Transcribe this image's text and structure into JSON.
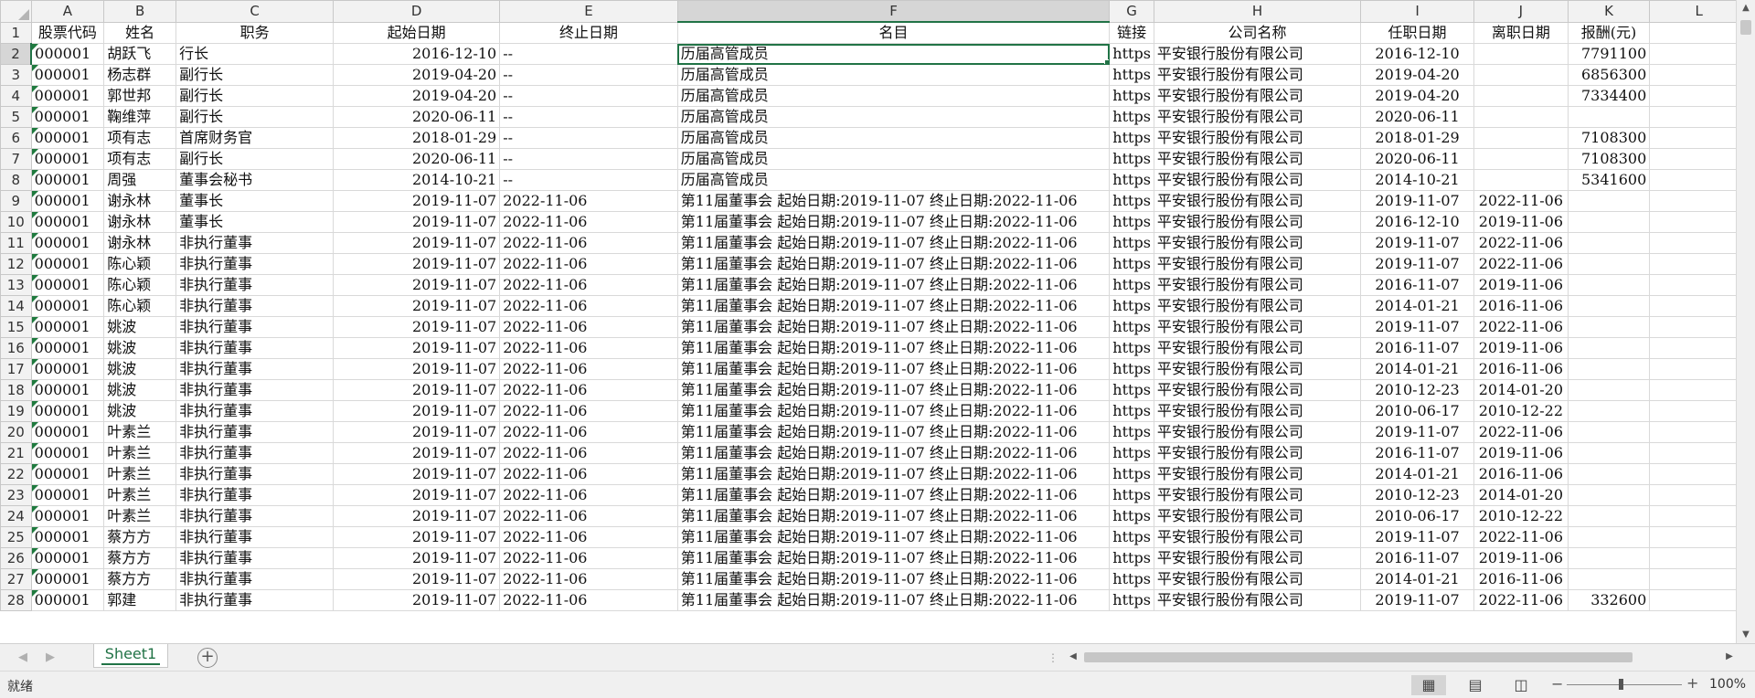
{
  "sheet": {
    "columns": [
      "A",
      "B",
      "C",
      "D",
      "E",
      "F",
      "G",
      "H",
      "I",
      "J",
      "K",
      "L"
    ],
    "selected_column": "F",
    "selected_row": 2,
    "rows": [
      {
        "n": "1",
        "c": [
          "股票代码",
          "姓名",
          "职务",
          "起始日期",
          "终止日期",
          "名目",
          "链接",
          "公司名称",
          "任职日期",
          "离职日期",
          "报酬(元)",
          ""
        ]
      },
      {
        "n": "2",
        "c": [
          "000001",
          "胡跃飞",
          "行长",
          "2016-12-10",
          "--",
          "历届高管成员",
          "https",
          "平安银行股份有限公司",
          "2016-12-10",
          "",
          "7791100",
          ""
        ]
      },
      {
        "n": "3",
        "c": [
          "000001",
          "杨志群",
          "副行长",
          "2019-04-20",
          "--",
          "历届高管成员",
          "https",
          "平安银行股份有限公司",
          "2019-04-20",
          "",
          "6856300",
          ""
        ]
      },
      {
        "n": "4",
        "c": [
          "000001",
          "郭世邦",
          "副行长",
          "2019-04-20",
          "--",
          "历届高管成员",
          "https",
          "平安银行股份有限公司",
          "2019-04-20",
          "",
          "7334400",
          ""
        ]
      },
      {
        "n": "5",
        "c": [
          "000001",
          "鞠维萍",
          "副行长",
          "2020-06-11",
          "--",
          "历届高管成员",
          "https",
          "平安银行股份有限公司",
          "2020-06-11",
          "",
          "",
          ""
        ]
      },
      {
        "n": "6",
        "c": [
          "000001",
          "项有志",
          "首席财务官",
          "2018-01-29",
          "--",
          "历届高管成员",
          "https",
          "平安银行股份有限公司",
          "2018-01-29",
          "",
          "7108300",
          ""
        ]
      },
      {
        "n": "7",
        "c": [
          "000001",
          "项有志",
          "副行长",
          "2020-06-11",
          "--",
          "历届高管成员",
          "https",
          "平安银行股份有限公司",
          "2020-06-11",
          "",
          "7108300",
          ""
        ]
      },
      {
        "n": "8",
        "c": [
          "000001",
          "周强",
          "董事会秘书",
          "2014-10-21",
          "--",
          "历届高管成员",
          "https",
          "平安银行股份有限公司",
          "2014-10-21",
          "",
          "5341600",
          ""
        ]
      },
      {
        "n": "9",
        "c": [
          "000001",
          "谢永林",
          "董事长",
          "2019-11-07",
          "2022-11-06",
          "第11届董事会  起始日期:2019-11-07  终止日期:2022-11-06",
          "https",
          "平安银行股份有限公司",
          "2019-11-07",
          "2022-11-06",
          "",
          ""
        ]
      },
      {
        "n": "10",
        "c": [
          "000001",
          "谢永林",
          "董事长",
          "2019-11-07",
          "2022-11-06",
          "第11届董事会  起始日期:2019-11-07  终止日期:2022-11-06",
          "https",
          "平安银行股份有限公司",
          "2016-12-10",
          "2019-11-06",
          "",
          ""
        ]
      },
      {
        "n": "11",
        "c": [
          "000001",
          "谢永林",
          "非执行董事",
          "2019-11-07",
          "2022-11-06",
          "第11届董事会  起始日期:2019-11-07  终止日期:2022-11-06",
          "https",
          "平安银行股份有限公司",
          "2019-11-07",
          "2022-11-06",
          "",
          ""
        ]
      },
      {
        "n": "12",
        "c": [
          "000001",
          "陈心颖",
          "非执行董事",
          "2019-11-07",
          "2022-11-06",
          "第11届董事会  起始日期:2019-11-07  终止日期:2022-11-06",
          "https",
          "平安银行股份有限公司",
          "2019-11-07",
          "2022-11-06",
          "",
          ""
        ]
      },
      {
        "n": "13",
        "c": [
          "000001",
          "陈心颖",
          "非执行董事",
          "2019-11-07",
          "2022-11-06",
          "第11届董事会  起始日期:2019-11-07  终止日期:2022-11-06",
          "https",
          "平安银行股份有限公司",
          "2016-11-07",
          "2019-11-06",
          "",
          ""
        ]
      },
      {
        "n": "14",
        "c": [
          "000001",
          "陈心颖",
          "非执行董事",
          "2019-11-07",
          "2022-11-06",
          "第11届董事会  起始日期:2019-11-07  终止日期:2022-11-06",
          "https",
          "平安银行股份有限公司",
          "2014-01-21",
          "2016-11-06",
          "",
          ""
        ]
      },
      {
        "n": "15",
        "c": [
          "000001",
          "姚波",
          "非执行董事",
          "2019-11-07",
          "2022-11-06",
          "第11届董事会  起始日期:2019-11-07  终止日期:2022-11-06",
          "https",
          "平安银行股份有限公司",
          "2019-11-07",
          "2022-11-06",
          "",
          ""
        ]
      },
      {
        "n": "16",
        "c": [
          "000001",
          "姚波",
          "非执行董事",
          "2019-11-07",
          "2022-11-06",
          "第11届董事会  起始日期:2019-11-07  终止日期:2022-11-06",
          "https",
          "平安银行股份有限公司",
          "2016-11-07",
          "2019-11-06",
          "",
          ""
        ]
      },
      {
        "n": "17",
        "c": [
          "000001",
          "姚波",
          "非执行董事",
          "2019-11-07",
          "2022-11-06",
          "第11届董事会  起始日期:2019-11-07  终止日期:2022-11-06",
          "https",
          "平安银行股份有限公司",
          "2014-01-21",
          "2016-11-06",
          "",
          ""
        ]
      },
      {
        "n": "18",
        "c": [
          "000001",
          "姚波",
          "非执行董事",
          "2019-11-07",
          "2022-11-06",
          "第11届董事会  起始日期:2019-11-07  终止日期:2022-11-06",
          "https",
          "平安银行股份有限公司",
          "2010-12-23",
          "2014-01-20",
          "",
          ""
        ]
      },
      {
        "n": "19",
        "c": [
          "000001",
          "姚波",
          "非执行董事",
          "2019-11-07",
          "2022-11-06",
          "第11届董事会  起始日期:2019-11-07  终止日期:2022-11-06",
          "https",
          "平安银行股份有限公司",
          "2010-06-17",
          "2010-12-22",
          "",
          ""
        ]
      },
      {
        "n": "20",
        "c": [
          "000001",
          "叶素兰",
          "非执行董事",
          "2019-11-07",
          "2022-11-06",
          "第11届董事会  起始日期:2019-11-07  终止日期:2022-11-06",
          "https",
          "平安银行股份有限公司",
          "2019-11-07",
          "2022-11-06",
          "",
          ""
        ]
      },
      {
        "n": "21",
        "c": [
          "000001",
          "叶素兰",
          "非执行董事",
          "2019-11-07",
          "2022-11-06",
          "第11届董事会  起始日期:2019-11-07  终止日期:2022-11-06",
          "https",
          "平安银行股份有限公司",
          "2016-11-07",
          "2019-11-06",
          "",
          ""
        ]
      },
      {
        "n": "22",
        "c": [
          "000001",
          "叶素兰",
          "非执行董事",
          "2019-11-07",
          "2022-11-06",
          "第11届董事会  起始日期:2019-11-07  终止日期:2022-11-06",
          "https",
          "平安银行股份有限公司",
          "2014-01-21",
          "2016-11-06",
          "",
          ""
        ]
      },
      {
        "n": "23",
        "c": [
          "000001",
          "叶素兰",
          "非执行董事",
          "2019-11-07",
          "2022-11-06",
          "第11届董事会  起始日期:2019-11-07  终止日期:2022-11-06",
          "https",
          "平安银行股份有限公司",
          "2010-12-23",
          "2014-01-20",
          "",
          ""
        ]
      },
      {
        "n": "24",
        "c": [
          "000001",
          "叶素兰",
          "非执行董事",
          "2019-11-07",
          "2022-11-06",
          "第11届董事会  起始日期:2019-11-07  终止日期:2022-11-06",
          "https",
          "平安银行股份有限公司",
          "2010-06-17",
          "2010-12-22",
          "",
          ""
        ]
      },
      {
        "n": "25",
        "c": [
          "000001",
          "蔡方方",
          "非执行董事",
          "2019-11-07",
          "2022-11-06",
          "第11届董事会  起始日期:2019-11-07  终止日期:2022-11-06",
          "https",
          "平安银行股份有限公司",
          "2019-11-07",
          "2022-11-06",
          "",
          ""
        ]
      },
      {
        "n": "26",
        "c": [
          "000001",
          "蔡方方",
          "非执行董事",
          "2019-11-07",
          "2022-11-06",
          "第11届董事会  起始日期:2019-11-07  终止日期:2022-11-06",
          "https",
          "平安银行股份有限公司",
          "2016-11-07",
          "2019-11-06",
          "",
          ""
        ]
      },
      {
        "n": "27",
        "c": [
          "000001",
          "蔡方方",
          "非执行董事",
          "2019-11-07",
          "2022-11-06",
          "第11届董事会  起始日期:2019-11-07  终止日期:2022-11-06",
          "https",
          "平安银行股份有限公司",
          "2014-01-21",
          "2016-11-06",
          "",
          ""
        ]
      },
      {
        "n": "28",
        "c": [
          "000001",
          "郭建",
          "非执行董事",
          "2019-11-07",
          "2022-11-06",
          "第11届董事会  起始日期:2019-11-07  终止日期:2022-11-06",
          "https",
          "平安银行股份有限公司",
          "2019-11-07",
          "2022-11-06",
          "332600",
          ""
        ]
      }
    ]
  },
  "tabs": [
    {
      "label": "Sheet1",
      "active": true
    }
  ],
  "status": {
    "text": "就绪",
    "zoom": "100%"
  },
  "icons": {
    "add_sheet": "plus-circle-icon",
    "normal_view": "grid-icon",
    "page_layout": "page-layout-icon",
    "page_break": "page-break-icon"
  },
  "colors": {
    "accent": "#217346",
    "header_bg": "#f2f2f2",
    "grid_line": "#d9d9d9"
  }
}
